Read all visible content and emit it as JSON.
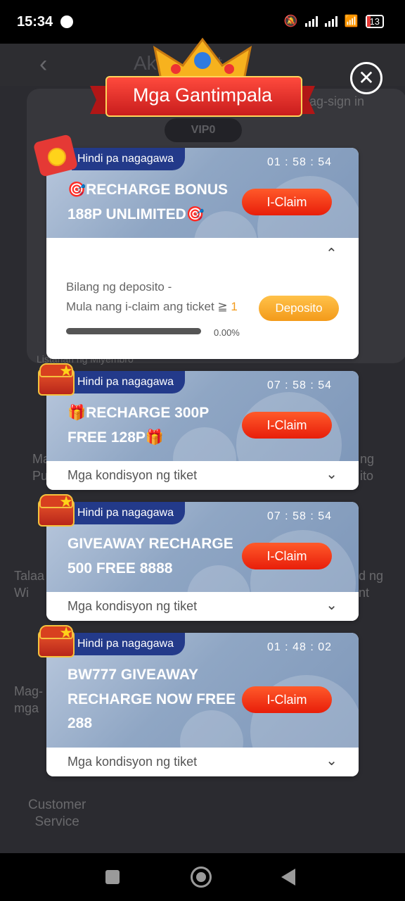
{
  "status_bar": {
    "time": "15:34",
    "battery": "13"
  },
  "background_app": {
    "title": "Ak     ount",
    "sign_in": "ag-sign in",
    "vip": "VIP0",
    "members_list": "Listahan ng Miyembro",
    "partial_left_1": "Ma\nPu",
    "partial_right_1": "ng\nito",
    "partial_left_2": "Talaa\nWi",
    "partial_right_2": "d ng\nnt",
    "partial_left_3": "Mag-\nmga",
    "customer_service": "Customer\nService"
  },
  "header": {
    "title": "Mga Gantimpala",
    "close_glyph": "✕"
  },
  "cards": [
    {
      "status": "Hindi pa nagagawa",
      "timer": "01 : 58 : 54",
      "title_line1": "🎯RECHARGE BONUS",
      "title_line2": "188P UNLIMITED🎯",
      "claim": "I-Claim",
      "expanded": true,
      "deposit_label": "Bilang ng deposito -",
      "deposit_condition": "Mula nang i-claim ang ticket ≧ ",
      "deposit_count": "1",
      "deposit_button": "Deposito",
      "progress_percent": 0,
      "progress_text": "0.00%"
    },
    {
      "status": "Hindi pa nagagawa",
      "timer": "07 : 58 : 54",
      "title_line1": "🎁RECHARGE 300P",
      "title_line2": "FREE 128P🎁",
      "claim": "I-Claim",
      "conditions": "Mga kondisyon ng tiket"
    },
    {
      "status": "Hindi pa nagagawa",
      "timer": "07 : 58 : 54",
      "title_line1": "GIVEAWAY RECHARGE",
      "title_line2": "500 FREE 8888",
      "claim": "I-Claim",
      "conditions": "Mga kondisyon ng tiket"
    },
    {
      "status": "Hindi pa nagagawa",
      "timer": "01 : 48 : 02",
      "title_line1": "BW777 GIVEAWAY",
      "title_line2": "RECHARGE NOW FREE",
      "title_line3": "288",
      "claim": "I-Claim",
      "conditions": "Mga kondisyon ng tiket"
    }
  ],
  "colors": {
    "claim": "#e81e0a",
    "deposit": "#f39a1a",
    "status_tag": "#233a8a",
    "ribbon": "#c91d1d"
  }
}
